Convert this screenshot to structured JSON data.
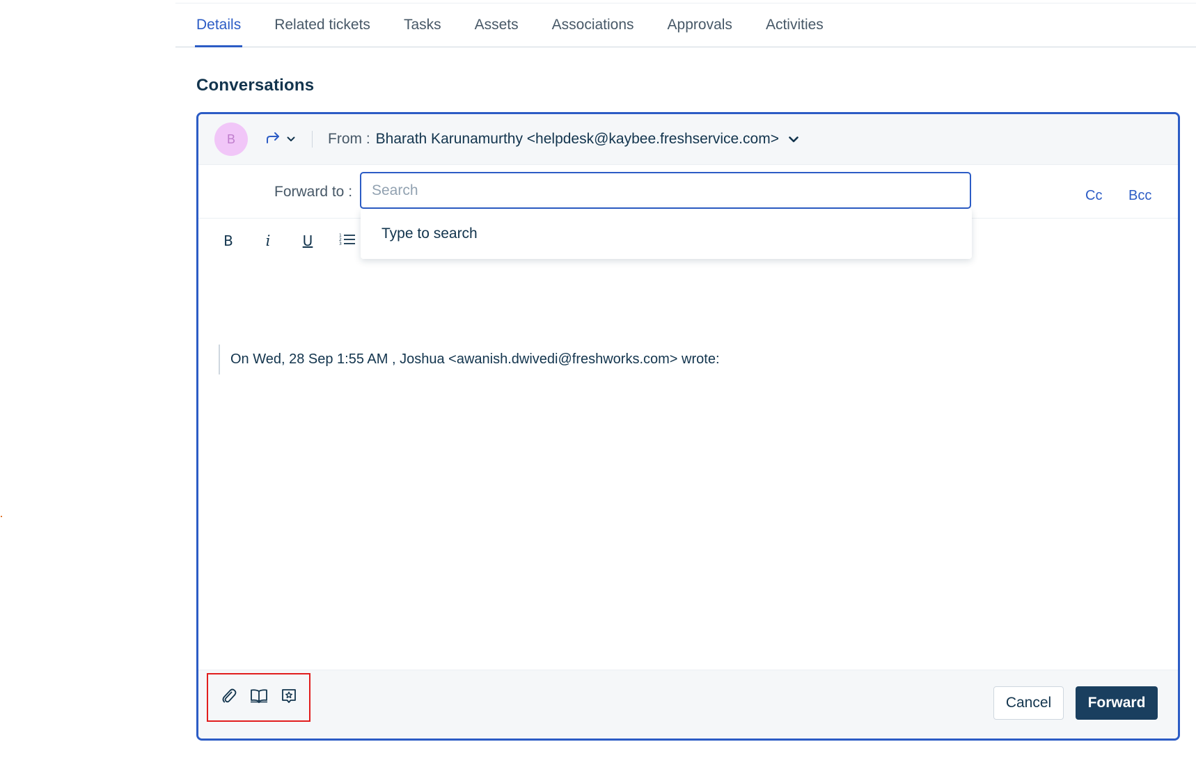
{
  "tabs": [
    {
      "label": "Details",
      "active": true
    },
    {
      "label": "Related tickets"
    },
    {
      "label": "Tasks"
    },
    {
      "label": "Assets"
    },
    {
      "label": "Associations"
    },
    {
      "label": "Approvals"
    },
    {
      "label": "Activities"
    }
  ],
  "section_title": "Conversations",
  "composer": {
    "avatar_initial": "B",
    "from_label": "From :",
    "from_value": "Bharath Karunamurthy <helpdesk@kaybee.freshservice.com>",
    "forward_to_label": "Forward to :",
    "search_placeholder": "Search",
    "search_value": "",
    "cc_label": "Cc",
    "bcc_label": "Bcc",
    "toolbar": {
      "bold": "B",
      "italic": "i",
      "underline": "U"
    },
    "dropdown_text": "Type to search",
    "quote_text": "On Wed, 28 Sep 1:55 AM , Joshua <awanish.dwivedi@freshworks.com> wrote:",
    "cancel_label": "Cancel",
    "forward_label": "Forward"
  },
  "colors": {
    "accent": "#2c5cc5",
    "primary_button": "#1a3f5f",
    "highlight_box": "#e11d1d",
    "avatar_bg": "#f1c6f8"
  },
  "icons": {
    "reply_type": "forward-arrow-icon",
    "attach": "paperclip-icon",
    "solutions": "book-icon",
    "canned": "message-star-icon"
  }
}
